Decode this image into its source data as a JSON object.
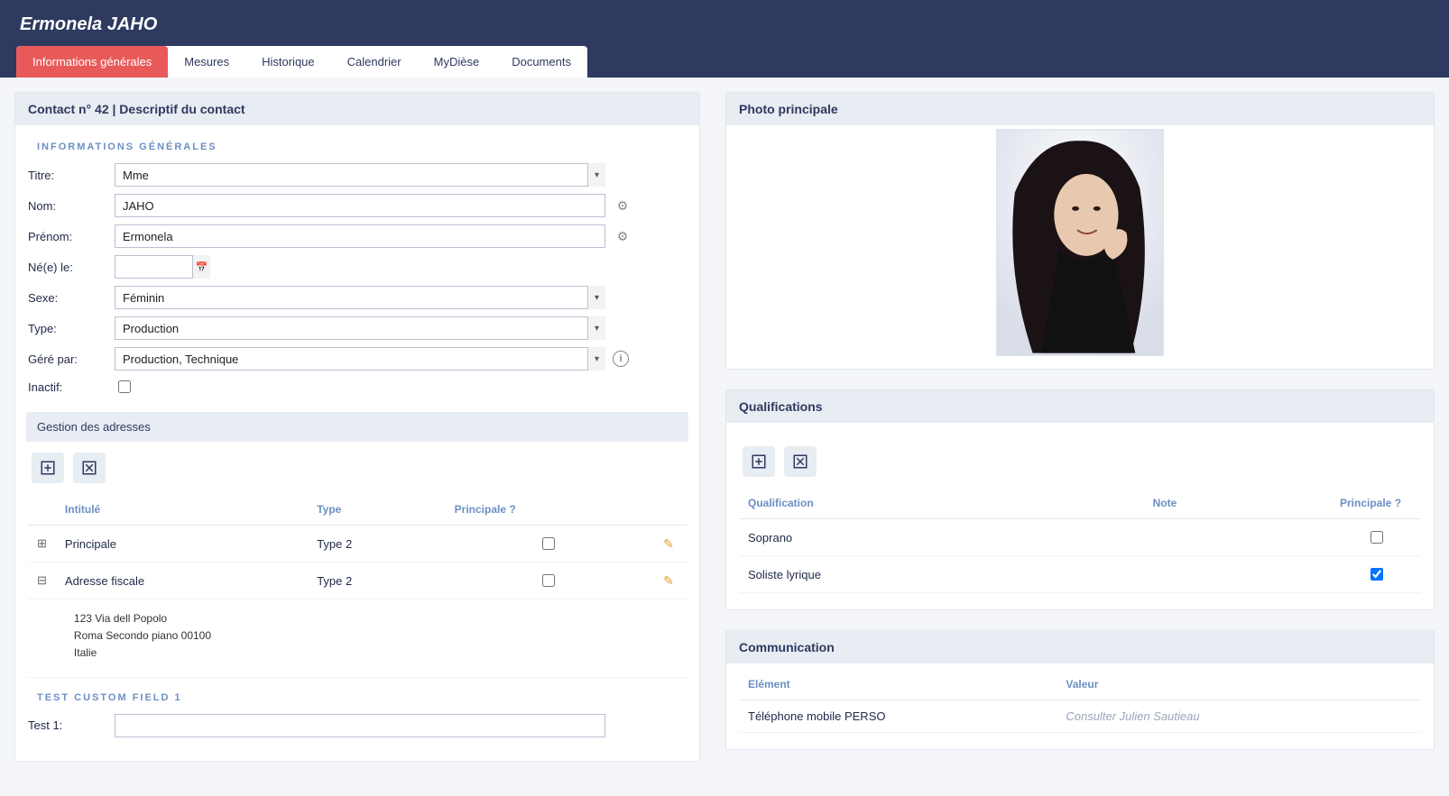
{
  "header": {
    "page_title": "Ermonela JAHO",
    "tabs": [
      {
        "label": "Informations générales",
        "active": true
      },
      {
        "label": "Mesures",
        "active": false
      },
      {
        "label": "Historique",
        "active": false
      },
      {
        "label": "Calendrier",
        "active": false
      },
      {
        "label": "MyDièse",
        "active": false
      },
      {
        "label": "Documents",
        "active": false
      }
    ]
  },
  "contact_panel": {
    "title": "Contact n° 42 | Descriptif du contact",
    "section_title": "INFORMATIONS GÉNÉRALES",
    "fields": {
      "titre_label": "Titre:",
      "titre_value": "Mme",
      "nom_label": "Nom:",
      "nom_value": "JAHO",
      "prenom_label": "Prénom:",
      "prenom_value": "Ermonela",
      "ne_label": "Né(e) le:",
      "ne_value": "",
      "sexe_label": "Sexe:",
      "sexe_value": "Féminin",
      "type_label": "Type:",
      "type_value": "Production",
      "gere_label": "Géré par:",
      "gere_value": "Production, Technique",
      "inactif_label": "Inactif:"
    }
  },
  "addresses": {
    "header": "Gestion des adresses",
    "columns": {
      "intitule": "Intitulé",
      "type": "Type",
      "principale": "Principale ?"
    },
    "rows": [
      {
        "intitule": "Principale",
        "type": "Type 2",
        "principale": false
      },
      {
        "intitule": "Adresse fiscale",
        "type": "Type 2",
        "principale": false
      }
    ],
    "details": {
      "line1": "123 Via dell Popolo",
      "line2": "Roma Secondo piano 00100",
      "line3": "Italie"
    }
  },
  "custom_fields": {
    "section_title": "TEST CUSTOM FIELD 1",
    "test1_label": "Test 1:"
  },
  "photo": {
    "header": "Photo principale"
  },
  "qualifications": {
    "header": "Qualifications",
    "columns": {
      "qual": "Qualification",
      "note": "Note",
      "principale": "Principale ?"
    },
    "rows": [
      {
        "qual": "Soprano",
        "note": "",
        "principale": false
      },
      {
        "qual": "Soliste lyrique",
        "note": "",
        "principale": true
      }
    ]
  },
  "communication": {
    "header": "Communication",
    "columns": {
      "element": "Elément",
      "valeur": "Valeur"
    },
    "rows": [
      {
        "element": "Téléphone mobile PERSO",
        "valeur": "Consulter Julien Sautieau"
      }
    ]
  }
}
